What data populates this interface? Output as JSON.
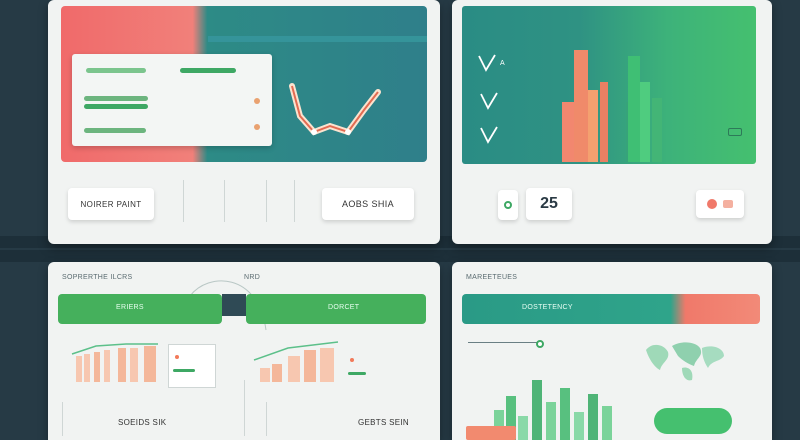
{
  "panel_tl": {
    "header_left": "",
    "header_mid": "",
    "header_right": "",
    "inner_label": "",
    "inner_value": "",
    "card_left": "NOIRER PAINT",
    "card_right": "AOBS SHIA"
  },
  "panel_tr": {
    "header_left": "",
    "header_mid": "",
    "header_right": "",
    "checks": [
      {
        "label": "A"
      },
      {
        "label": ""
      },
      {
        "label": ""
      }
    ],
    "metric_value": "25",
    "colors": {
      "teal": "#2f8f84",
      "green": "#3fbf74",
      "salmon": "#f08a6a"
    }
  },
  "panel_bl": {
    "title": "SOPRERTHE ILCRS",
    "tag": "NRD",
    "tab_left": "ERIERS",
    "tab_right": "DORCET",
    "footer_left": "SOEIDS SIK",
    "footer_right": "GEBTS SEIN"
  },
  "panel_br": {
    "title": "MAREETEUES",
    "tab": "DOSTETENCY"
  },
  "colors": {
    "accent_green": "#3fae5f",
    "accent_teal": "#2a8a86",
    "accent_salmon": "#f0796a"
  }
}
